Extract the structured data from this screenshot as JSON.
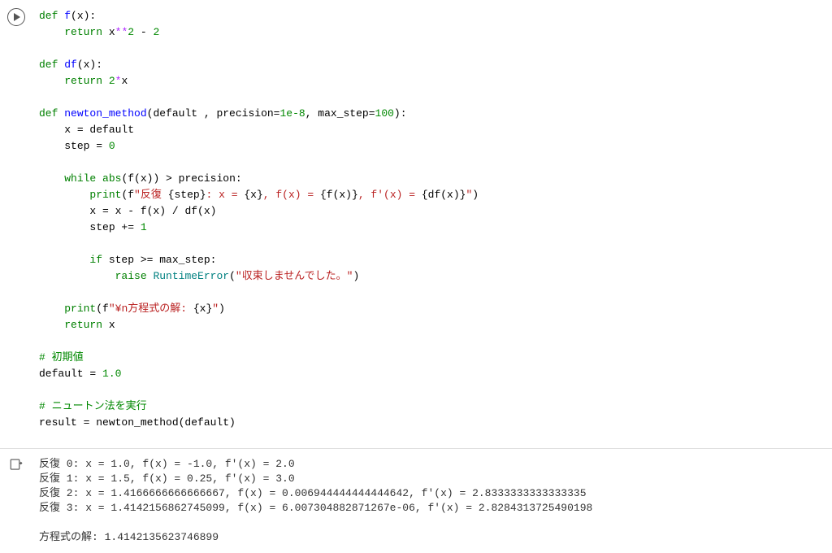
{
  "code": {
    "l1": {
      "kw": "def",
      "fn": "f",
      "rest": "(x):"
    },
    "l2": {
      "kw": "return",
      "expr": "x",
      "op": "**",
      "num": "2",
      "minus": " - ",
      "num2": "2"
    },
    "l4": {
      "kw": "def",
      "fn": "df",
      "rest": "(x):"
    },
    "l5": {
      "kw": "return",
      "num": "2",
      "op": "*",
      "expr": "x"
    },
    "l7": {
      "kw": "def",
      "fn": "newton_method",
      "params": "(default , precision=",
      "num1": "1e-8",
      "comma": ", max_step=",
      "num2": "100",
      "close": "):"
    },
    "l8": {
      "expr": "x = default"
    },
    "l9": {
      "expr": "step = ",
      "num": "0"
    },
    "l11": {
      "kw": "while",
      "builtin": "abs",
      "expr1": "(f(x)) > precision:"
    },
    "l12": {
      "builtin": "print",
      "open": "(f",
      "str1": "\"反復 ",
      "brace1": "{",
      "var1": "step",
      "brace2": "}",
      "str2": ": x = ",
      "brace3": "{",
      "var2": "x",
      "brace4": "}",
      "str3": ", f(x) = ",
      "brace5": "{",
      "var3": "f(x)",
      "brace6": "}",
      "str4": ", f'(x) = ",
      "brace7": "{",
      "var4": "df(x)",
      "brace8": "}",
      "strend": "\"",
      "close": ")"
    },
    "l13": {
      "expr": "x = x - f(x) / df(x)"
    },
    "l14": {
      "expr": "step += ",
      "num": "1"
    },
    "l16": {
      "kw": "if",
      "expr": " step >= max_step:"
    },
    "l17": {
      "kw": "raise",
      "err": "RuntimeError",
      "open": "(",
      "str": "\"収束しませんでした。\"",
      "close": ")"
    },
    "l19": {
      "builtin": "print",
      "open": "(f",
      "str1": "\"¥n方程式の解: ",
      "brace1": "{",
      "var": "x",
      "brace2": "}",
      "strend": "\"",
      "close": ")"
    },
    "l20": {
      "kw": "return",
      "expr": " x"
    },
    "l22": {
      "comment": "# 初期値"
    },
    "l23": {
      "expr": "default = ",
      "num": "1.0"
    },
    "l25": {
      "comment": "# ニュートン法を実行"
    },
    "l26": {
      "expr": "result = newton_method(default)"
    }
  },
  "output": {
    "line1": "反復 0: x = 1.0, f(x) = -1.0, f'(x) = 2.0",
    "line2": "反復 1: x = 1.5, f(x) = 0.25, f'(x) = 3.0",
    "line3": "反復 2: x = 1.4166666666666667, f(x) = 0.006944444444444642, f'(x) = 2.8333333333333335",
    "line4": "反復 3: x = 1.4142156862745099, f(x) = 6.007304882871267e-06, f'(x) = 2.8284313725490198",
    "line6": "方程式の解: 1.4142135623746899"
  }
}
